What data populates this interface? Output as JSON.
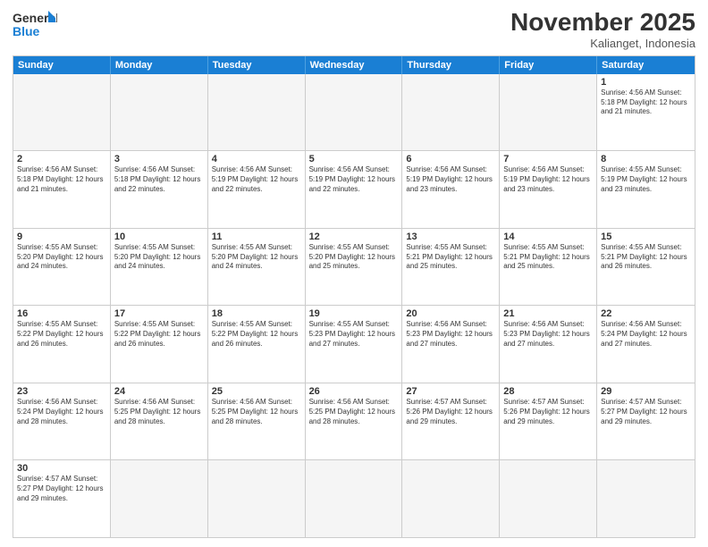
{
  "logo": {
    "general": "General",
    "blue": "Blue"
  },
  "title": "November 2025",
  "subtitle": "Kalianget, Indonesia",
  "days": [
    "Sunday",
    "Monday",
    "Tuesday",
    "Wednesday",
    "Thursday",
    "Friday",
    "Saturday"
  ],
  "weeks": [
    [
      {
        "day": "",
        "info": "",
        "empty": true
      },
      {
        "day": "",
        "info": "",
        "empty": true
      },
      {
        "day": "",
        "info": "",
        "empty": true
      },
      {
        "day": "",
        "info": "",
        "empty": true
      },
      {
        "day": "",
        "info": "",
        "empty": true
      },
      {
        "day": "",
        "info": "",
        "empty": true
      },
      {
        "day": "1",
        "info": "Sunrise: 4:56 AM\nSunset: 5:18 PM\nDaylight: 12 hours and 21 minutes.",
        "empty": false
      }
    ],
    [
      {
        "day": "2",
        "info": "Sunrise: 4:56 AM\nSunset: 5:18 PM\nDaylight: 12 hours and 21 minutes.",
        "empty": false
      },
      {
        "day": "3",
        "info": "Sunrise: 4:56 AM\nSunset: 5:18 PM\nDaylight: 12 hours and 22 minutes.",
        "empty": false
      },
      {
        "day": "4",
        "info": "Sunrise: 4:56 AM\nSunset: 5:19 PM\nDaylight: 12 hours and 22 minutes.",
        "empty": false
      },
      {
        "day": "5",
        "info": "Sunrise: 4:56 AM\nSunset: 5:19 PM\nDaylight: 12 hours and 22 minutes.",
        "empty": false
      },
      {
        "day": "6",
        "info": "Sunrise: 4:56 AM\nSunset: 5:19 PM\nDaylight: 12 hours and 23 minutes.",
        "empty": false
      },
      {
        "day": "7",
        "info": "Sunrise: 4:56 AM\nSunset: 5:19 PM\nDaylight: 12 hours and 23 minutes.",
        "empty": false
      },
      {
        "day": "8",
        "info": "Sunrise: 4:55 AM\nSunset: 5:19 PM\nDaylight: 12 hours and 23 minutes.",
        "empty": false
      }
    ],
    [
      {
        "day": "9",
        "info": "Sunrise: 4:55 AM\nSunset: 5:20 PM\nDaylight: 12 hours and 24 minutes.",
        "empty": false
      },
      {
        "day": "10",
        "info": "Sunrise: 4:55 AM\nSunset: 5:20 PM\nDaylight: 12 hours and 24 minutes.",
        "empty": false
      },
      {
        "day": "11",
        "info": "Sunrise: 4:55 AM\nSunset: 5:20 PM\nDaylight: 12 hours and 24 minutes.",
        "empty": false
      },
      {
        "day": "12",
        "info": "Sunrise: 4:55 AM\nSunset: 5:20 PM\nDaylight: 12 hours and 25 minutes.",
        "empty": false
      },
      {
        "day": "13",
        "info": "Sunrise: 4:55 AM\nSunset: 5:21 PM\nDaylight: 12 hours and 25 minutes.",
        "empty": false
      },
      {
        "day": "14",
        "info": "Sunrise: 4:55 AM\nSunset: 5:21 PM\nDaylight: 12 hours and 25 minutes.",
        "empty": false
      },
      {
        "day": "15",
        "info": "Sunrise: 4:55 AM\nSunset: 5:21 PM\nDaylight: 12 hours and 26 minutes.",
        "empty": false
      }
    ],
    [
      {
        "day": "16",
        "info": "Sunrise: 4:55 AM\nSunset: 5:22 PM\nDaylight: 12 hours and 26 minutes.",
        "empty": false
      },
      {
        "day": "17",
        "info": "Sunrise: 4:55 AM\nSunset: 5:22 PM\nDaylight: 12 hours and 26 minutes.",
        "empty": false
      },
      {
        "day": "18",
        "info": "Sunrise: 4:55 AM\nSunset: 5:22 PM\nDaylight: 12 hours and 26 minutes.",
        "empty": false
      },
      {
        "day": "19",
        "info": "Sunrise: 4:55 AM\nSunset: 5:23 PM\nDaylight: 12 hours and 27 minutes.",
        "empty": false
      },
      {
        "day": "20",
        "info": "Sunrise: 4:56 AM\nSunset: 5:23 PM\nDaylight: 12 hours and 27 minutes.",
        "empty": false
      },
      {
        "day": "21",
        "info": "Sunrise: 4:56 AM\nSunset: 5:23 PM\nDaylight: 12 hours and 27 minutes.",
        "empty": false
      },
      {
        "day": "22",
        "info": "Sunrise: 4:56 AM\nSunset: 5:24 PM\nDaylight: 12 hours and 27 minutes.",
        "empty": false
      }
    ],
    [
      {
        "day": "23",
        "info": "Sunrise: 4:56 AM\nSunset: 5:24 PM\nDaylight: 12 hours and 28 minutes.",
        "empty": false
      },
      {
        "day": "24",
        "info": "Sunrise: 4:56 AM\nSunset: 5:25 PM\nDaylight: 12 hours and 28 minutes.",
        "empty": false
      },
      {
        "day": "25",
        "info": "Sunrise: 4:56 AM\nSunset: 5:25 PM\nDaylight: 12 hours and 28 minutes.",
        "empty": false
      },
      {
        "day": "26",
        "info": "Sunrise: 4:56 AM\nSunset: 5:25 PM\nDaylight: 12 hours and 28 minutes.",
        "empty": false
      },
      {
        "day": "27",
        "info": "Sunrise: 4:57 AM\nSunset: 5:26 PM\nDaylight: 12 hours and 29 minutes.",
        "empty": false
      },
      {
        "day": "28",
        "info": "Sunrise: 4:57 AM\nSunset: 5:26 PM\nDaylight: 12 hours and 29 minutes.",
        "empty": false
      },
      {
        "day": "29",
        "info": "Sunrise: 4:57 AM\nSunset: 5:27 PM\nDaylight: 12 hours and 29 minutes.",
        "empty": false
      }
    ],
    [
      {
        "day": "30",
        "info": "Sunrise: 4:57 AM\nSunset: 5:27 PM\nDaylight: 12 hours and 29 minutes.",
        "empty": false
      },
      {
        "day": "",
        "info": "",
        "empty": true
      },
      {
        "day": "",
        "info": "",
        "empty": true
      },
      {
        "day": "",
        "info": "",
        "empty": true
      },
      {
        "day": "",
        "info": "",
        "empty": true
      },
      {
        "day": "",
        "info": "",
        "empty": true
      },
      {
        "day": "",
        "info": "",
        "empty": true
      }
    ]
  ]
}
